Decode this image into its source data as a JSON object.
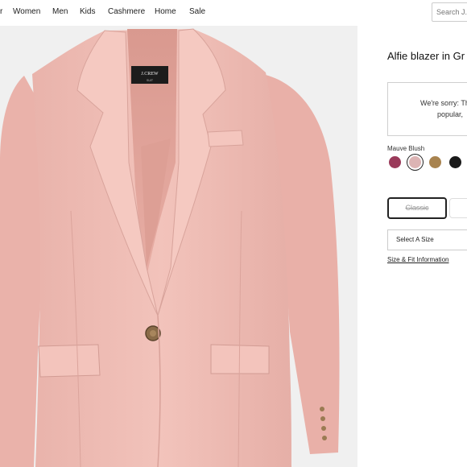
{
  "nav": {
    "items": [
      "Women",
      "Men",
      "Kids",
      "Cashmere",
      "Home",
      "Sale"
    ],
    "search_placeholder": "Search J.Crew"
  },
  "product": {
    "image": {
      "brand_label": "J.CREW",
      "label_subtext": "SUIT"
    },
    "title": "Alfie blazer in Gr",
    "notice": {
      "line1": "We're sorry: Th",
      "line2": "popular,"
    },
    "color_label": "Mauve Blush",
    "swatches": [
      {
        "name": "berry",
        "color": "#9a3a5a"
      },
      {
        "name": "mauve-blush",
        "color": "#dcb4b4"
      },
      {
        "name": "camel",
        "color": "#a8834f"
      },
      {
        "name": "black",
        "color": "#1a1a1a"
      }
    ],
    "fit_options": [
      "Classic",
      ""
    ],
    "size_select": "Select A Size",
    "size_fit_link": "Size & Fit Information"
  }
}
